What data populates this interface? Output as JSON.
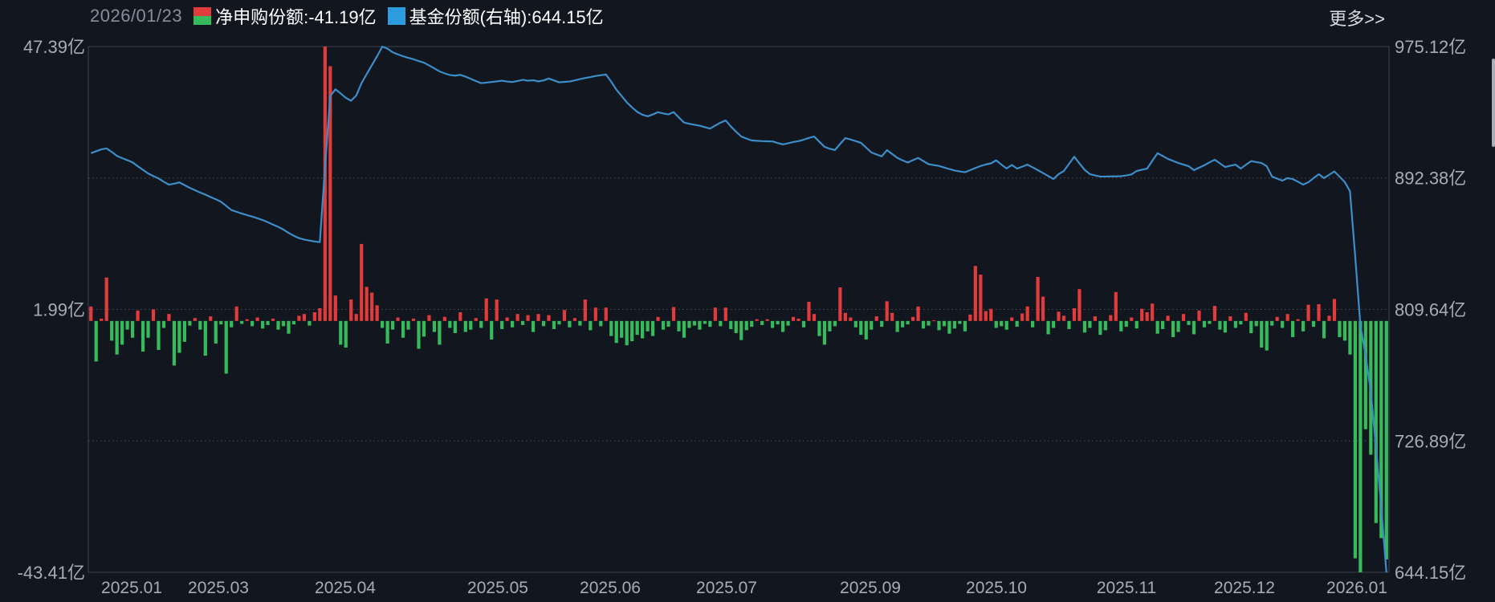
{
  "header": {
    "date": "2026/01/23",
    "legend_bar_text": "净申购份额:-41.19亿",
    "legend_line_text": "基金份额(右轴):644.15亿",
    "more_link": "更多>>"
  },
  "colors": {
    "background": "#12161f",
    "bar_positive": "#e23b3b",
    "bar_negative": "#35bb5c",
    "line": "#3d8dc8",
    "legend_line_marker": "#2e9de0",
    "axis_label": "#a6acb8",
    "date_text": "#858e9d",
    "grid_line": "#4a4f5a",
    "border": "#3c414c"
  },
  "chart_data": {
    "type": "bar+line",
    "title": "",
    "grid": "dotted horizontal",
    "legend_position": "top",
    "x_axis": {
      "labels": [
        {
          "text": "2025.01",
          "pos": 164
        },
        {
          "text": "2025.03",
          "pos": 272
        },
        {
          "text": "2025.04",
          "pos": 430
        },
        {
          "text": "2025.05",
          "pos": 620
        },
        {
          "text": "2025.06",
          "pos": 760
        },
        {
          "text": "2025.07",
          "pos": 905
        },
        {
          "text": "2025.09",
          "pos": 1084
        },
        {
          "text": "2025.10",
          "pos": 1241
        },
        {
          "text": "2025.11",
          "pos": 1403
        },
        {
          "text": "2025.12",
          "pos": 1550
        },
        {
          "text": "2026.01",
          "pos": 1690
        }
      ]
    },
    "left_axis": {
      "unit": "亿",
      "max": 47.39,
      "min": -43.41,
      "ticks": [
        {
          "label": "47.39亿",
          "value": 47.39
        },
        {
          "label": "1.99亿",
          "value": 1.99
        },
        {
          "label": "-43.41亿",
          "value": -43.41
        }
      ]
    },
    "right_axis": {
      "unit": "亿",
      "max": 975.12,
      "min": 644.15,
      "ticks": [
        {
          "label": "975.12亿",
          "value": 975.12
        },
        {
          "label": "892.38亿",
          "value": 892.38
        },
        {
          "label": "809.64亿",
          "value": 809.64
        },
        {
          "label": "726.89亿",
          "value": 726.89
        },
        {
          "label": "644.15亿",
          "value": 644.15
        }
      ]
    },
    "series": [
      {
        "name": "净申购份额",
        "type": "bar",
        "axis": "left",
        "unit": "亿",
        "current_value": -41.19,
        "values": [
          2.5,
          -7.0,
          0.4,
          7.5,
          -3.4,
          -5.8,
          -4.1,
          -1.5,
          -2.9,
          1.8,
          -5.3,
          -2.9,
          2.0,
          -5.0,
          -1.2,
          1.2,
          -7.7,
          -5.5,
          -3.6,
          -0.8,
          0.5,
          -1.5,
          -6.0,
          0.8,
          -3.9,
          -0.6,
          -9.1,
          -1.1,
          2.5,
          -0.5,
          0.3,
          -0.9,
          0.6,
          -1.3,
          -0.7,
          0.4,
          -1.5,
          -0.9,
          -2.2,
          -0.6,
          0.9,
          1.2,
          -0.8,
          1.5,
          2.2,
          47.39,
          44.0,
          4.4,
          -4.1,
          -4.6,
          3.7,
          1.2,
          13.3,
          5.9,
          4.9,
          2.7,
          -1.2,
          -3.9,
          -1.5,
          0.6,
          -2.9,
          -1.5,
          0.4,
          -4.8,
          -2.7,
          1.0,
          -1.9,
          -4.1,
          0.7,
          -1.2,
          -2.1,
          1.5,
          -1.9,
          -1.5,
          0.5,
          -1.2,
          3.9,
          -3.2,
          3.7,
          -1.4,
          0.6,
          -1.1,
          1.2,
          -0.7,
          1.0,
          -1.9,
          1.2,
          -0.9,
          1.0,
          -1.4,
          -0.6,
          1.9,
          -1.1,
          0.5,
          -0.8,
          3.7,
          -1.6,
          2.3,
          -0.9,
          2.3,
          -2.6,
          -3.8,
          -2.9,
          -4.2,
          -3.5,
          -2.4,
          -3.0,
          -1.8,
          -2.6,
          0.7,
          -1.5,
          -1.0,
          2.4,
          -1.8,
          -2.9,
          -1.2,
          -0.8,
          -1.5,
          -0.5,
          -1.0,
          2.3,
          -0.9,
          2.3,
          -1.4,
          -2.1,
          -3.3,
          -1.6,
          -1.0,
          0.3,
          -0.7,
          0.3,
          -1.2,
          -0.6,
          -1.9,
          -0.8,
          0.7,
          0.4,
          -1.1,
          3.3,
          1.2,
          -2.6,
          -4.1,
          -1.8,
          -0.9,
          5.8,
          1.4,
          0.6,
          -1.1,
          -2.4,
          -3.2,
          -1.5,
          0.8,
          -1.0,
          3.4,
          1.4,
          -1.9,
          -1.1,
          -0.6,
          0.7,
          2.5,
          -1.3,
          -0.8,
          0.1,
          -1.6,
          -0.9,
          -2.2,
          -1.3,
          -0.5,
          -1.8,
          1.1,
          9.5,
          8.0,
          1.7,
          2.1,
          -1.2,
          -0.9,
          -1.5,
          0.6,
          -1.0,
          1.3,
          2.5,
          -1.1,
          7.6,
          4.2,
          -2.3,
          -1.2,
          1.6,
          0.9,
          -1.4,
          2.2,
          5.5,
          -2.0,
          -1.2,
          0.8,
          -2.4,
          -1.6,
          1.0,
          5.0,
          -1.8,
          -1.0,
          0.6,
          -1.3,
          2.1,
          1.5,
          3.0,
          -2.2,
          -1.4,
          0.9,
          -2.8,
          -1.9,
          1.2,
          -0.7,
          -2.3,
          1.8,
          -1.1,
          -0.5,
          2.6,
          -1.5,
          -2.0,
          0.8,
          -1.2,
          -0.6,
          1.4,
          -2.1,
          -0.9,
          -4.6,
          -5.1,
          -0.8,
          0.7,
          -1.2,
          1.2,
          -2.8,
          0.3,
          -1.8,
          2.8,
          -1.0,
          2.9,
          -3.0,
          0.9,
          3.8,
          -2.8,
          -3.4,
          -5.8,
          -41.0,
          -43.41,
          -18.7,
          -23.1,
          -34.9,
          -37.5,
          -41.19
        ]
      },
      {
        "name": "基金份额(右轴)",
        "type": "line",
        "axis": "right",
        "unit": "亿",
        "current_value": 644.15,
        "values": [
          908.0,
          909.2,
          910.4,
          911.0,
          908.8,
          906.3,
          904.9,
          903.6,
          902.2,
          899.8,
          897.5,
          895.2,
          893.6,
          892.1,
          890.0,
          888.2,
          888.8,
          889.6,
          887.9,
          886.2,
          884.7,
          883.2,
          881.9,
          880.4,
          879.0,
          877.4,
          874.8,
          872.2,
          871.1,
          870.0,
          869.0,
          868.1,
          867.0,
          865.9,
          864.5,
          863.0,
          861.6,
          859.9,
          857.8,
          856.0,
          854.5,
          853.6,
          853.0,
          852.4,
          852.0,
          899.4,
          944.0,
          948.2,
          945.6,
          942.8,
          941.0,
          944.3,
          952.0,
          957.8,
          963.4,
          969.0,
          975.12,
          973.8,
          971.5,
          970.2,
          969.0,
          968.0,
          967.1,
          966.0,
          965.0,
          963.2,
          961.4,
          959.5,
          958.2,
          957.2,
          956.8,
          957.3,
          956.2,
          954.8,
          953.4,
          952.1,
          952.4,
          952.8,
          953.2,
          953.6,
          953.1,
          952.8,
          953.4,
          954.2,
          953.6,
          953.9,
          953.2,
          953.8,
          955.0,
          953.8,
          952.6,
          952.9,
          953.1,
          953.8,
          954.6,
          955.3,
          955.9,
          956.6,
          957.1,
          957.5,
          953.0,
          948.0,
          944.0,
          940.0,
          936.8,
          934.0,
          932.2,
          931.2,
          932.4,
          933.8,
          933.0,
          932.4,
          933.9,
          930.5,
          927.3,
          926.5,
          925.9,
          925.3,
          924.4,
          923.5,
          925.4,
          927.2,
          928.6,
          924.8,
          921.5,
          918.5,
          917.2,
          916.0,
          915.8,
          915.6,
          915.5,
          915.4,
          914.4,
          913.5,
          914.2,
          915.0,
          915.6,
          916.5,
          917.6,
          918.5,
          915.2,
          912.0,
          910.8,
          910.0,
          913.8,
          917.5,
          916.6,
          915.6,
          914.5,
          911.5,
          908.5,
          907.2,
          906.0,
          909.9,
          907.5,
          905.0,
          903.5,
          902.1,
          903.6,
          905.0,
          903.0,
          901.1,
          900.5,
          900.0,
          899.0,
          898.0,
          897.1,
          896.5,
          896.0,
          897.3,
          898.7,
          899.9,
          900.9,
          901.6,
          903.5,
          900.8,
          898.4,
          900.6,
          898.3,
          899.5,
          900.8,
          899.1,
          897.3,
          895.5,
          893.6,
          891.7,
          894.8,
          896.8,
          901.3,
          905.8,
          901.5,
          897.5,
          894.8,
          894.0,
          893.3,
          893.3,
          893.4,
          893.4,
          893.5,
          894.0,
          894.6,
          896.8,
          897.6,
          898.3,
          903.2,
          908.0,
          906.2,
          904.4,
          903.1,
          901.8,
          900.8,
          899.8,
          897.3,
          898.9,
          900.4,
          902.2,
          903.9,
          901.6,
          899.3,
          900.1,
          900.8,
          898.3,
          900.7,
          903.0,
          902.4,
          901.8,
          899.8,
          893.3,
          892.0,
          890.7,
          892.3,
          891.7,
          890.0,
          888.2,
          889.7,
          892.3,
          894.8,
          892.3,
          894.4,
          896.5,
          893.2,
          889.8,
          884.0,
          843.0,
          799.6,
          780.9,
          757.8,
          722.9,
          685.4,
          644.15
        ]
      }
    ]
  }
}
